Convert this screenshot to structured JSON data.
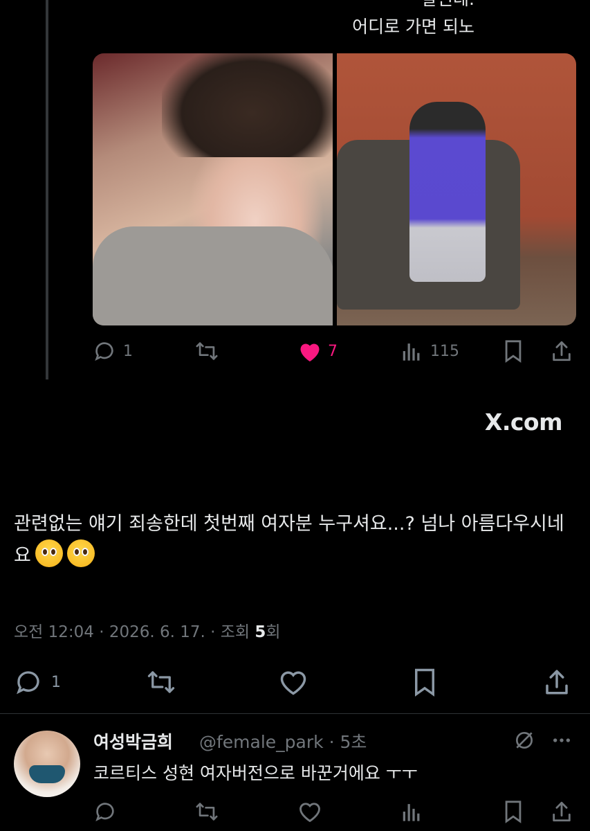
{
  "quoted": {
    "text_cut": "알린데.",
    "text": "어디로 가면 되노",
    "stats": {
      "replies": "1",
      "likes": "7",
      "views": "115"
    }
  },
  "source": "X.com",
  "tweet": {
    "text": "관련없는 얘기 죄송한데 첫번째 여자분 누구셔요...? 넘나 아름다우시네요",
    "meta_prefix": "오전 12:04 · 2026. 6. 17. · 조회 ",
    "views": "5",
    "views_suffix": "회",
    "replies": "1"
  },
  "reply": {
    "name": "여성박금희",
    "handle": "@female_park · 5초",
    "text": "코르티스 성현 여자버전으로 바꾼거에요 ㅜㅜ"
  },
  "colors": {
    "bg": "#000000",
    "text": "#e7e9ea",
    "muted": "#71767b",
    "like": "#f91880",
    "divider": "#2f3336"
  }
}
